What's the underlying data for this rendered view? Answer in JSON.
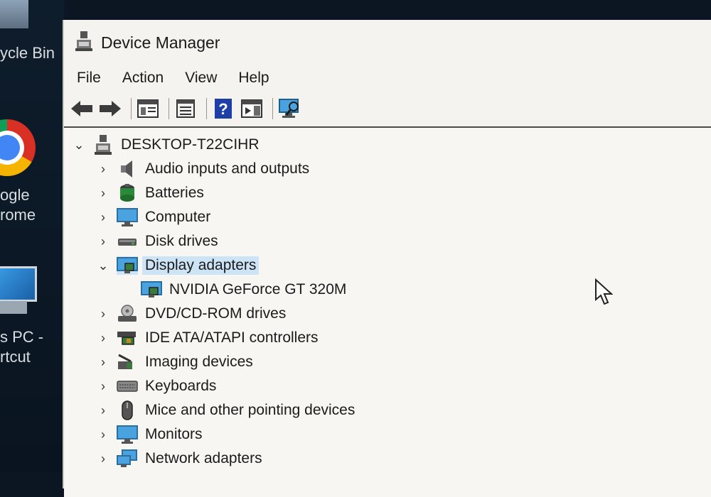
{
  "desktop": {
    "recycle_bin_label": "ycle Bin",
    "chrome_label_line1": "ogle",
    "chrome_label_line2": "rome",
    "thispc_label_line1": "s PC -",
    "thispc_label_line2": "rtcut"
  },
  "window": {
    "title": "Device Manager",
    "menu": [
      "File",
      "Action",
      "View",
      "Help"
    ],
    "toolbar_icons": [
      "back-arrow-icon",
      "forward-arrow-icon",
      "show-hide-tree-icon",
      "properties-icon",
      "help-icon",
      "action-pane-icon",
      "scan-hardware-icon"
    ]
  },
  "tree": {
    "root": "DESKTOP-T22CIHR",
    "categories": [
      {
        "label": "Audio inputs and outputs",
        "icon": "speaker-icon",
        "expanded": false
      },
      {
        "label": "Batteries",
        "icon": "battery-icon",
        "expanded": false
      },
      {
        "label": "Computer",
        "icon": "monitor-icon",
        "expanded": false
      },
      {
        "label": "Disk drives",
        "icon": "disk-drive-icon",
        "expanded": false
      },
      {
        "label": "Display adapters",
        "icon": "display-adapter-icon",
        "expanded": true,
        "selected": true,
        "children": [
          "NVIDIA GeForce GT 320M"
        ]
      },
      {
        "label": "DVD/CD-ROM drives",
        "icon": "dvd-drive-icon",
        "expanded": false
      },
      {
        "label": "IDE ATA/ATAPI controllers",
        "icon": "ide-controller-icon",
        "expanded": false
      },
      {
        "label": "Imaging devices",
        "icon": "camera-icon",
        "expanded": false
      },
      {
        "label": "Keyboards",
        "icon": "keyboard-icon",
        "expanded": false
      },
      {
        "label": "Mice and other pointing devices",
        "icon": "mouse-icon",
        "expanded": false
      },
      {
        "label": "Monitors",
        "icon": "monitor-icon",
        "expanded": false
      },
      {
        "label": "Network adapters",
        "icon": "network-icon",
        "expanded": false
      }
    ]
  },
  "colors": {
    "selection": "#cde3f6",
    "window_bg": "#f4f3ef",
    "desktop_bg": "#0b1622"
  }
}
